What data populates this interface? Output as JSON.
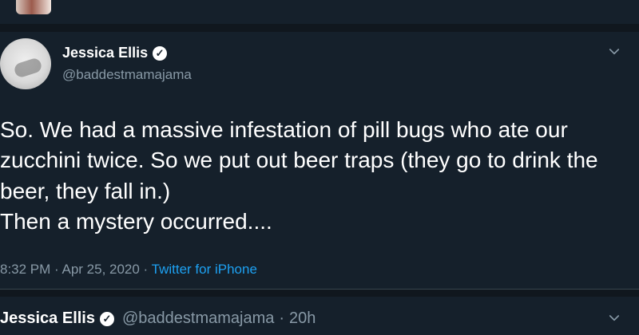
{
  "colors": {
    "background": "#15202b",
    "gap": "#10171e",
    "text": "#ffffff",
    "secondary": "#8899a6",
    "accent": "#1da1f2"
  },
  "tweet": {
    "author_name": "Jessica Ellis",
    "handle": "@baddestmamajama",
    "text": "So. We had a massive infestation of pill bugs who ate our zucchini twice. So we put out beer traps (they go to drink the beer, they fall in.)\nThen a mystery occurred....",
    "time": "8:32 PM · Apr 25, 2020 · ",
    "source": "Twitter for iPhone",
    "icons": {
      "verified": "verified-badge-icon",
      "more": "chevron-down-icon"
    }
  },
  "next_tweet": {
    "author_name": "Jessica Ellis",
    "handle": "@baddestmamajama",
    "separator": "·",
    "time": "20h"
  }
}
